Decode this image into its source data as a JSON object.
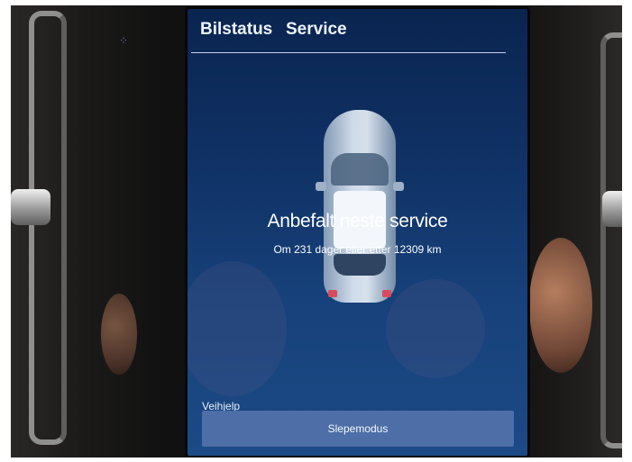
{
  "tabs": [
    {
      "label": "Bilstatus"
    },
    {
      "label": "Service"
    }
  ],
  "service": {
    "title": "Anbefalt neste service",
    "subtitle": "Om 231 dager eller etter 12309 km"
  },
  "roadside": {
    "section_label": "Veihjelp",
    "tow_mode_label": "Slepemodus"
  },
  "colors": {
    "screen_background": "#103266",
    "button": "#4d6ea6",
    "text": "#ffffff"
  },
  "icons": {
    "car": "car-top-view-icon"
  }
}
